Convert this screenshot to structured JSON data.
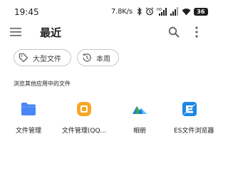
{
  "status_bar": {
    "time": "19:45",
    "net_speed": "7.8K/s",
    "battery": "36",
    "icons": [
      "bluetooth-icon",
      "alarm-icon",
      "signal-hd-icon",
      "signal-icon",
      "wifi-icon",
      "battery-icon"
    ]
  },
  "app_bar": {
    "title": "最近",
    "icons": [
      "menu-icon",
      "search-icon",
      "more-vert-icon"
    ]
  },
  "filters": [
    {
      "label": "大型文件",
      "icon": "label-tag-icon"
    },
    {
      "label": "本周",
      "icon": "history-clock-icon"
    }
  ],
  "section": {
    "title": "浏览其他应用中的文件"
  },
  "apps": [
    {
      "label": "文件管理",
      "icon": "folder-icon",
      "color": "#4a86f7"
    },
    {
      "label": "文件管理(QQ...",
      "icon": "qq-file-manager-icon",
      "color": "#f6a623"
    },
    {
      "label": "相册",
      "icon": "gallery-mountain-icon",
      "color": "#1a73e8"
    },
    {
      "label": "ES文件浏览器",
      "icon": "es-file-explorer-icon",
      "color": "#1e88e5"
    }
  ]
}
